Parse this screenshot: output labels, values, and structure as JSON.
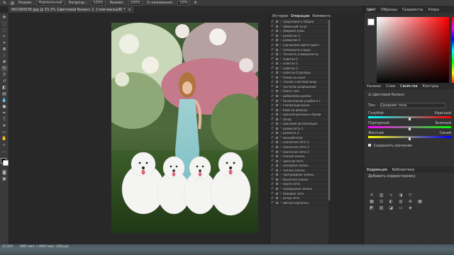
{
  "options_bar": {
    "mode_label": "Режим:",
    "mode_value": "Нормальный",
    "opacity_label": "Непрозр.:",
    "opacity_value": "100%",
    "flow_label": "Нажим:",
    "flow_value": "100%",
    "smoothing_label": "Сглаживание:",
    "smoothing_value": "10%"
  },
  "document_tab": {
    "title": "00C0A5535.jpg @ 33,3% (Цветовой баланс 2, Слой-маска/8) *",
    "close": "×"
  },
  "history_panel": {
    "tabs": [
      "История",
      "Операции",
      "Комментар"
    ],
    "items": [
      "сворачиватъ (общее",
      "обменный гунуг",
      "убираем зумы",
      "размытие 1",
      "размытие 2",
      "улучшение цвета (щего",
      "пятемность кадра",
      "Четкость и микроконтр",
      "осветли 1",
      "осветли 2",
      "осветли 3",
      "осветли 4 (розовы",
      "блики на коже",
      "тонкие счастлив кожу",
      "чистепок разрешение",
      "блеск глаз",
      "добавляем румяна",
      "Белоснежная улыбка и з",
      "стилизация волос",
      "блик на волосах",
      "красная реснице и брови",
      "загар",
      "красивая детализация",
      "размытость 1",
      "резкость 2",
      "монхуйготов",
      "оказочное лето 1",
      "оказочное лето 2",
      "оказочное лето 3",
      "сонной зелень",
      "цветная лето",
      "холодная зелень",
      "теплая зелень",
      "пригородное зелень",
      "болотная зелень",
      "марта лето",
      "изумрудная зелень",
      "бежевое лето",
      "ретро лето",
      "мягкая картинка"
    ],
    "check_glyph": "✓"
  },
  "color_panel": {
    "tabs": [
      "Цвет",
      "Образцы",
      "Градиенты",
      "Узоры"
    ],
    "accent": "#ff0000"
  },
  "properties_panel": {
    "tabs": [
      "Каналы",
      "Слои",
      "Свойства",
      "Контуры"
    ],
    "title": "Цветовой баланс",
    "tone_label": "Тон:",
    "tone_value": "Средние тона",
    "slider1": {
      "left": "Голубой",
      "right": "Красный",
      "value": 0.5
    },
    "slider2": {
      "left": "Пурпурный",
      "right": "Зеленый",
      "value": 0.5
    },
    "slider3": {
      "left": "Желтый",
      "right": "Синий",
      "value": 0.5
    },
    "preserve_label": "Сохранить свечение"
  },
  "adjustments_panel": {
    "tabs": [
      "Коррекция",
      "Библиотеки"
    ],
    "subtitle": "Добавить корректировку"
  },
  "status_bar": {
    "zoom": "33,33%",
    "doc_size": "3965 пикс. х 4845 пикс. (300 ppi)"
  }
}
